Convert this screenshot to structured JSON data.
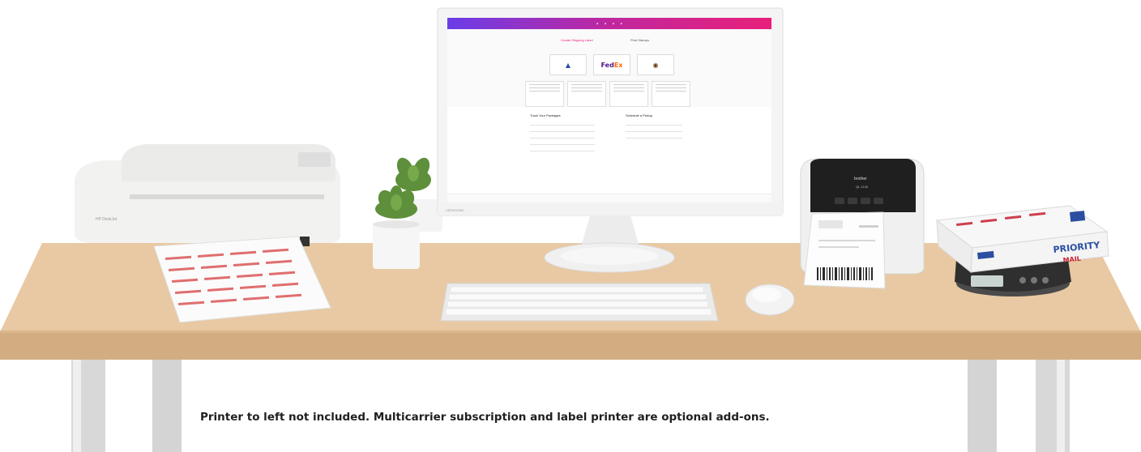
{
  "caption": "Printer to left not included. Multicarrier subscription and label printer are optional add-ons.",
  "screen": {
    "heading": "Create Shipping Label",
    "tab": "Print Stamps",
    "carriers": [
      "USPS",
      "FedEx",
      "UPS"
    ],
    "left_table_title": "Track Your Packages",
    "right_table_title": "Schedule a Pickup"
  },
  "box": {
    "brand_line": "PRIORITY",
    "brand_line2": "MAIL"
  },
  "colors": {
    "desk": "#e6c39a",
    "desk_edge": "#cfa77a",
    "screen_gradient_start": "#6a3de8",
    "screen_gradient_end": "#e8207a",
    "usps_blue": "#2a4fa1",
    "usps_red": "#c8202f"
  }
}
